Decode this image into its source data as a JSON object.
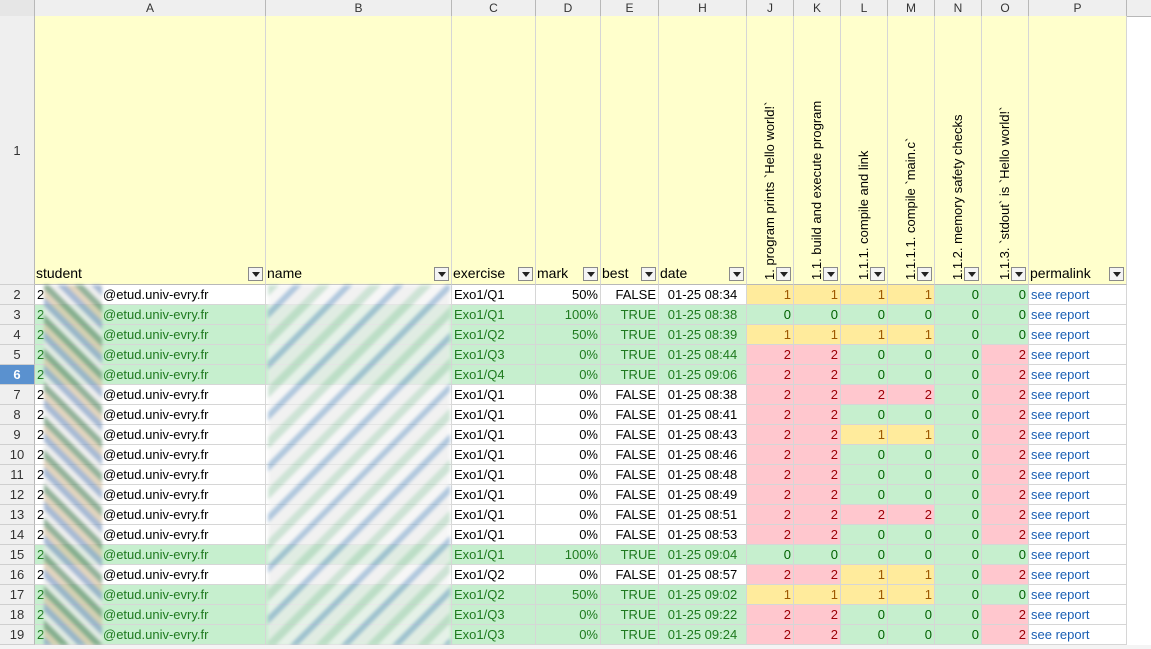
{
  "columns": [
    "A",
    "B",
    "C",
    "D",
    "E",
    "H",
    "J",
    "K",
    "L",
    "M",
    "N",
    "O",
    "P"
  ],
  "header": {
    "row_number": "1",
    "student": "student",
    "name": "name",
    "exercise": "exercise",
    "mark": "mark",
    "best": "best",
    "date": "date",
    "permalink": "permalink",
    "checks": [
      "1. program prints `Hello world!`",
      "1.1. build and execute program",
      "1.1.1. compile and link",
      "1.1.1.1. compile `main.c`",
      "1.1.2. memory safety checks",
      "1.1.3. `stdout` is `Hello world!`"
    ]
  },
  "selected_row": "6",
  "rows": [
    {
      "n": "2",
      "student_prefix": "2",
      "email": "@etud.univ-evry.fr",
      "exercise": "Exo1/Q1",
      "mark": "50%",
      "best": "FALSE",
      "date": "01-25 08:34",
      "checks": [
        "1",
        "1",
        "1",
        "1",
        "0",
        "0"
      ],
      "link": "see report",
      "hl": false
    },
    {
      "n": "3",
      "student_prefix": "2",
      "email": "@etud.univ-evry.fr",
      "exercise": "Exo1/Q1",
      "mark": "100%",
      "best": "TRUE",
      "date": "01-25 08:38",
      "checks": [
        "0",
        "0",
        "0",
        "0",
        "0",
        "0"
      ],
      "link": "see report",
      "hl": true
    },
    {
      "n": "4",
      "student_prefix": "2",
      "email": "@etud.univ-evry.fr",
      "exercise": "Exo1/Q2",
      "mark": "50%",
      "best": "TRUE",
      "date": "01-25 08:39",
      "checks": [
        "1",
        "1",
        "1",
        "1",
        "0",
        "0"
      ],
      "link": "see report",
      "hl": true
    },
    {
      "n": "5",
      "student_prefix": "2",
      "email": "@etud.univ-evry.fr",
      "exercise": "Exo1/Q3",
      "mark": "0%",
      "best": "TRUE",
      "date": "01-25 08:44",
      "checks": [
        "2",
        "2",
        "0",
        "0",
        "0",
        "2"
      ],
      "link": "see report",
      "hl": true
    },
    {
      "n": "6",
      "student_prefix": "2",
      "email": "@etud.univ-evry.fr",
      "exercise": "Exo1/Q4",
      "mark": "0%",
      "best": "TRUE",
      "date": "01-25 09:06",
      "checks": [
        "2",
        "2",
        "0",
        "0",
        "0",
        "2"
      ],
      "link": "see report",
      "hl": true
    },
    {
      "n": "7",
      "student_prefix": "2",
      "email": "@etud.univ-evry.fr",
      "exercise": "Exo1/Q1",
      "mark": "0%",
      "best": "FALSE",
      "date": "01-25 08:38",
      "checks": [
        "2",
        "2",
        "2",
        "2",
        "0",
        "2"
      ],
      "link": "see report",
      "hl": false
    },
    {
      "n": "8",
      "student_prefix": "2",
      "email": "@etud.univ-evry.fr",
      "exercise": "Exo1/Q1",
      "mark": "0%",
      "best": "FALSE",
      "date": "01-25 08:41",
      "checks": [
        "2",
        "2",
        "0",
        "0",
        "0",
        "2"
      ],
      "link": "see report",
      "hl": false
    },
    {
      "n": "9",
      "student_prefix": "2",
      "email": "@etud.univ-evry.fr",
      "exercise": "Exo1/Q1",
      "mark": "0%",
      "best": "FALSE",
      "date": "01-25 08:43",
      "checks": [
        "2",
        "2",
        "1",
        "1",
        "0",
        "2"
      ],
      "link": "see report",
      "hl": false
    },
    {
      "n": "10",
      "student_prefix": "2",
      "email": "@etud.univ-evry.fr",
      "exercise": "Exo1/Q1",
      "mark": "0%",
      "best": "FALSE",
      "date": "01-25 08:46",
      "checks": [
        "2",
        "2",
        "0",
        "0",
        "0",
        "2"
      ],
      "link": "see report",
      "hl": false
    },
    {
      "n": "11",
      "student_prefix": "2",
      "email": "@etud.univ-evry.fr",
      "exercise": "Exo1/Q1",
      "mark": "0%",
      "best": "FALSE",
      "date": "01-25 08:48",
      "checks": [
        "2",
        "2",
        "0",
        "0",
        "0",
        "2"
      ],
      "link": "see report",
      "hl": false
    },
    {
      "n": "12",
      "student_prefix": "2",
      "email": "@etud.univ-evry.fr",
      "exercise": "Exo1/Q1",
      "mark": "0%",
      "best": "FALSE",
      "date": "01-25 08:49",
      "checks": [
        "2",
        "2",
        "0",
        "0",
        "0",
        "2"
      ],
      "link": "see report",
      "hl": false
    },
    {
      "n": "13",
      "student_prefix": "2",
      "email": "@etud.univ-evry.fr",
      "exercise": "Exo1/Q1",
      "mark": "0%",
      "best": "FALSE",
      "date": "01-25 08:51",
      "checks": [
        "2",
        "2",
        "2",
        "2",
        "0",
        "2"
      ],
      "link": "see report",
      "hl": false
    },
    {
      "n": "14",
      "student_prefix": "2",
      "email": "@etud.univ-evry.fr",
      "exercise": "Exo1/Q1",
      "mark": "0%",
      "best": "FALSE",
      "date": "01-25 08:53",
      "checks": [
        "2",
        "2",
        "0",
        "0",
        "0",
        "2"
      ],
      "link": "see report",
      "hl": false
    },
    {
      "n": "15",
      "student_prefix": "2",
      "email": "@etud.univ-evry.fr",
      "exercise": "Exo1/Q1",
      "mark": "100%",
      "best": "TRUE",
      "date": "01-25 09:04",
      "checks": [
        "0",
        "0",
        "0",
        "0",
        "0",
        "0"
      ],
      "link": "see report",
      "hl": true
    },
    {
      "n": "16",
      "student_prefix": "2",
      "email": "@etud.univ-evry.fr",
      "exercise": "Exo1/Q2",
      "mark": "0%",
      "best": "FALSE",
      "date": "01-25 08:57",
      "checks": [
        "2",
        "2",
        "1",
        "1",
        "0",
        "2"
      ],
      "link": "see report",
      "hl": false
    },
    {
      "n": "17",
      "student_prefix": "2",
      "email": "@etud.univ-evry.fr",
      "exercise": "Exo1/Q2",
      "mark": "50%",
      "best": "TRUE",
      "date": "01-25 09:02",
      "checks": [
        "1",
        "1",
        "1",
        "1",
        "0",
        "0"
      ],
      "link": "see report",
      "hl": true
    },
    {
      "n": "18",
      "student_prefix": "2",
      "email": "@etud.univ-evry.fr",
      "exercise": "Exo1/Q3",
      "mark": "0%",
      "best": "TRUE",
      "date": "01-25 09:22",
      "checks": [
        "2",
        "2",
        "0",
        "0",
        "0",
        "2"
      ],
      "link": "see report",
      "hl": true
    },
    {
      "n": "19",
      "student_prefix": "2",
      "email": "@etud.univ-evry.fr",
      "exercise": "Exo1/Q3",
      "mark": "0%",
      "best": "TRUE",
      "date": "01-25 09:24",
      "checks": [
        "2",
        "2",
        "0",
        "0",
        "0",
        "2"
      ],
      "link": "see report",
      "hl": true
    }
  ],
  "colors": {
    "header_fill": "#ffffcc",
    "best_row_fill": "#c6efce",
    "check_fail": "#ffc7ce",
    "check_partial": "#ffeb9c",
    "check_pass": "#c6efce",
    "selection": "#5a91cf"
  }
}
